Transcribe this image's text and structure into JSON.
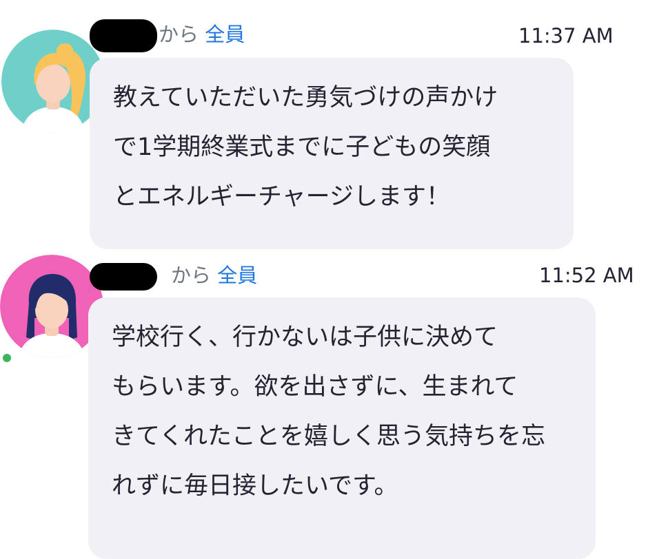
{
  "messages": [
    {
      "from_label": "から",
      "to_label": "全員",
      "time": "11:37 AM",
      "lines": [
        "教えていただいた勇気づけの声かけ",
        "で1学期終業式までに子どもの笑顔",
        "とエネルギーチャージします！"
      ],
      "avatar_icon": "woman-blonde-avatar-icon",
      "avatar_bg": "#6fcfc9"
    },
    {
      "from_label": "から",
      "to_label": "全員",
      "time": "11:52 AM",
      "lines": [
        "学校行く、行かないは子供に決めて",
        "もらいます。欲を出さずに、生まれて",
        "きてくれたことを嬉しく思う気持ちを忘",
        "れずに毎日接したいです。"
      ],
      "avatar_icon": "woman-dark-hair-avatar-icon",
      "avatar_bg": "#f062b8"
    }
  ]
}
